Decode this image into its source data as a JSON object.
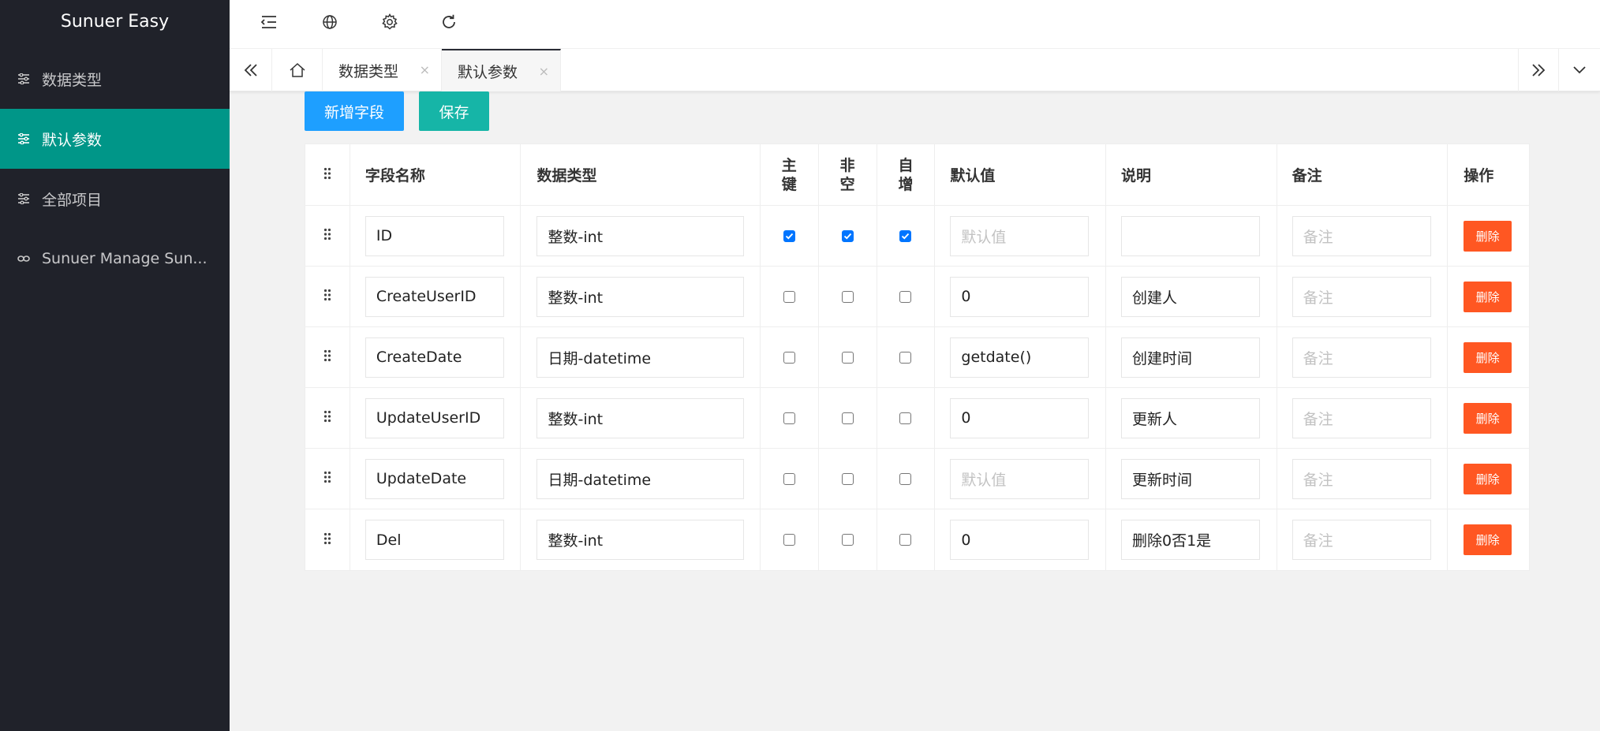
{
  "app": {
    "title": "Sunuer Easy"
  },
  "sidebar": {
    "items": [
      {
        "label": "数据类型",
        "icon": "sliders-icon",
        "active": false
      },
      {
        "label": "默认参数",
        "icon": "sliders-icon",
        "active": true
      },
      {
        "label": "全部项目",
        "icon": "sliders-icon",
        "active": false
      },
      {
        "label": "Sunuer Manage Sun...",
        "icon": "link-icon",
        "active": false
      }
    ]
  },
  "header": {
    "icons": [
      "menu-indent-icon",
      "globe-icon",
      "gear-icon",
      "refresh-icon"
    ]
  },
  "tabs": [
    {
      "label": "数据类型",
      "close": "×"
    },
    {
      "label": "默认参数",
      "close": "×"
    }
  ],
  "actions": {
    "add_label": "新增字段",
    "save_label": "保存"
  },
  "table": {
    "headers": {
      "name": "字段名称",
      "type": "数据类型",
      "pk": [
        "主",
        "键"
      ],
      "notnull": [
        "非",
        "空"
      ],
      "autoinc": [
        "自",
        "增"
      ],
      "default": "默认值",
      "desc": "说明",
      "remark": "备注",
      "op": "操作"
    },
    "placeholders": {
      "default": "默认值",
      "remark": "备注"
    },
    "delete_label": "删除",
    "rows": [
      {
        "name": "ID",
        "type": "整数-int",
        "pk": true,
        "notnull": true,
        "autoinc": true,
        "default": "",
        "desc": "",
        "remark": ""
      },
      {
        "name": "CreateUserID",
        "type": "整数-int",
        "pk": false,
        "notnull": false,
        "autoinc": false,
        "default": "0",
        "desc": "创建人",
        "remark": ""
      },
      {
        "name": "CreateDate",
        "type": "日期-datetime",
        "pk": false,
        "notnull": false,
        "autoinc": false,
        "default": "getdate()",
        "desc": "创建时间",
        "remark": ""
      },
      {
        "name": "UpdateUserID",
        "type": "整数-int",
        "pk": false,
        "notnull": false,
        "autoinc": false,
        "default": "0",
        "desc": "更新人",
        "remark": ""
      },
      {
        "name": "UpdateDate",
        "type": "日期-datetime",
        "pk": false,
        "notnull": false,
        "autoinc": false,
        "default": "",
        "desc": "更新时间",
        "remark": ""
      },
      {
        "name": "Del",
        "type": "整数-int",
        "pk": false,
        "notnull": false,
        "autoinc": false,
        "default": "0",
        "desc": "删除0否1是",
        "remark": ""
      }
    ]
  },
  "colors": {
    "sidebar_bg": "#20222a",
    "active": "#009688",
    "add_btn": "#1e9fff",
    "save_btn": "#16b5a7",
    "delete_btn": "#ff5722"
  }
}
